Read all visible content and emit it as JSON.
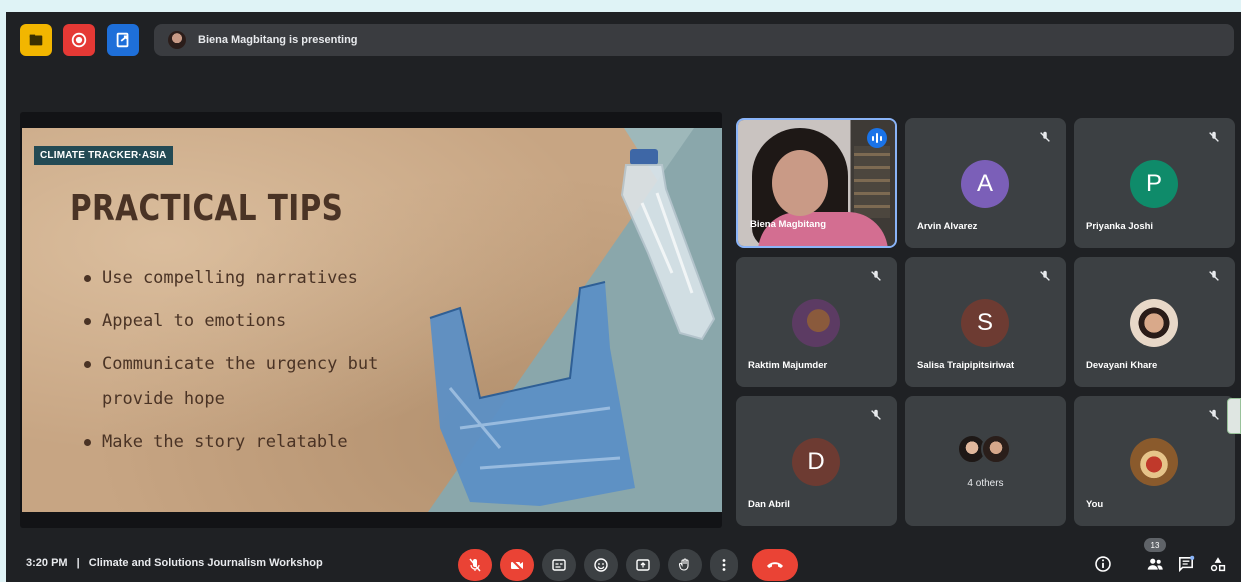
{
  "topbar": {
    "presenting_text": "Biena Magbitang is presenting"
  },
  "slide": {
    "brand": "CLIMATE TRACKER·ASIA",
    "title": "PRACTICAL TIPS",
    "tips": [
      "Use compelling narratives",
      "Appeal to emotions",
      "Communicate the urgency but",
      "provide hope",
      "Make the story relatable"
    ]
  },
  "participants": [
    {
      "name": "Biena Magbitang"
    },
    {
      "name": "Arvin Alvarez",
      "initial": "A",
      "color": "#7b5fb8"
    },
    {
      "name": "Priyanka Joshi",
      "initial": "P",
      "color": "#0f8b6a"
    },
    {
      "name": "Raktim Majumder"
    },
    {
      "name": "Salisa Traipipitsiriwat",
      "initial": "S",
      "color": "#6d3b32"
    },
    {
      "name": "Devayani Khare"
    },
    {
      "name": "Dan Abril",
      "initial": "D",
      "color": "#6d3b32"
    },
    {
      "name": "4 others"
    },
    {
      "name": "You"
    }
  ],
  "footer": {
    "time": "3:20 PM",
    "separator": "|",
    "meeting_title": "Climate and Solutions Journalism Workshop",
    "participant_count": "13"
  },
  "colors": {
    "accent": "#1a73e8",
    "danger": "#ea4335",
    "tile_bg": "#3c4043"
  }
}
